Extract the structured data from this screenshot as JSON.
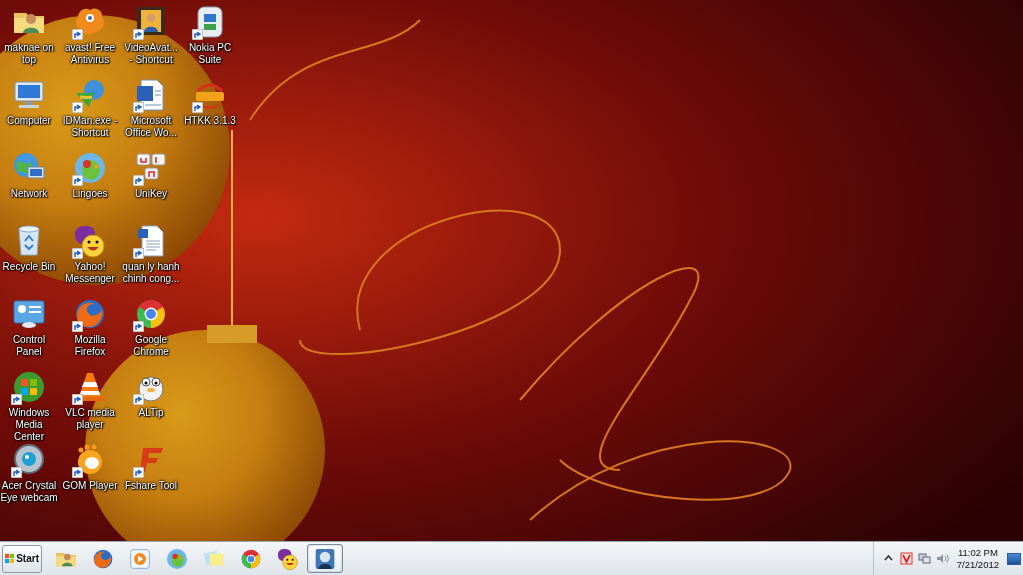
{
  "desktop_icons": [
    {
      "label": "maknae on top",
      "kind": "folder",
      "shortcut": false
    },
    {
      "label": "Computer",
      "kind": "computer",
      "shortcut": false
    },
    {
      "label": "Network",
      "kind": "network",
      "shortcut": false
    },
    {
      "label": "Recycle Bin",
      "kind": "bin",
      "shortcut": false
    },
    {
      "label": "Control Panel",
      "kind": "panel",
      "shortcut": false
    },
    {
      "label": "Windows Media Center",
      "kind": "orb",
      "shortcut": true
    },
    {
      "label": "Acer Crystal Eye webcam",
      "kind": "webcam",
      "shortcut": true
    },
    {
      "label": "avast! Free Antivirus",
      "kind": "avast",
      "shortcut": true
    },
    {
      "label": "IDMan.exe - Shortcut",
      "kind": "download",
      "shortcut": true
    },
    {
      "label": "Lingoes",
      "kind": "parrot",
      "shortcut": true
    },
    {
      "label": "Yahoo! Messenger",
      "kind": "yahoo",
      "shortcut": true
    },
    {
      "label": "Mozilla Firefox",
      "kind": "firefox",
      "shortcut": true
    },
    {
      "label": "VLC media player",
      "kind": "cone",
      "shortcut": true
    },
    {
      "label": "GOM Player",
      "kind": "gom",
      "shortcut": true
    },
    {
      "label": "VideoAvat... - Shortcut",
      "kind": "film",
      "shortcut": true
    },
    {
      "label": "Microsoft Office Wo...",
      "kind": "word",
      "shortcut": true
    },
    {
      "label": "UniKey",
      "kind": "keys",
      "shortcut": true
    },
    {
      "label": "quan ly hanh chinh cong...",
      "kind": "document",
      "shortcut": true
    },
    {
      "label": "Google Chrome",
      "kind": "chrome",
      "shortcut": true
    },
    {
      "label": "ALTip",
      "kind": "cartoon",
      "shortcut": true
    },
    {
      "label": "Fshare Tool",
      "kind": "letter",
      "shortcut": true
    },
    {
      "label": "Nokia PC Suite",
      "kind": "phone",
      "shortcut": true
    },
    {
      "label": "HTKK 3.1.3",
      "kind": "htkk",
      "shortcut": true
    }
  ],
  "taskbar": {
    "start": "Start",
    "items": [
      {
        "kind": "folder",
        "selected": false
      },
      {
        "kind": "firefox",
        "selected": false
      },
      {
        "kind": "player",
        "selected": false
      },
      {
        "kind": "parrot",
        "selected": false
      },
      {
        "kind": "notes",
        "selected": false
      },
      {
        "kind": "chrome",
        "selected": false
      },
      {
        "kind": "yahoo",
        "selected": false
      },
      {
        "kind": "avatar",
        "selected": true
      }
    ],
    "tray": {
      "icons": [
        {
          "kind": "caret"
        },
        {
          "kind": "antivirus"
        },
        {
          "kind": "network"
        },
        {
          "kind": "volume"
        }
      ],
      "time": "11:02 PM",
      "date": "7/21/2012"
    }
  }
}
